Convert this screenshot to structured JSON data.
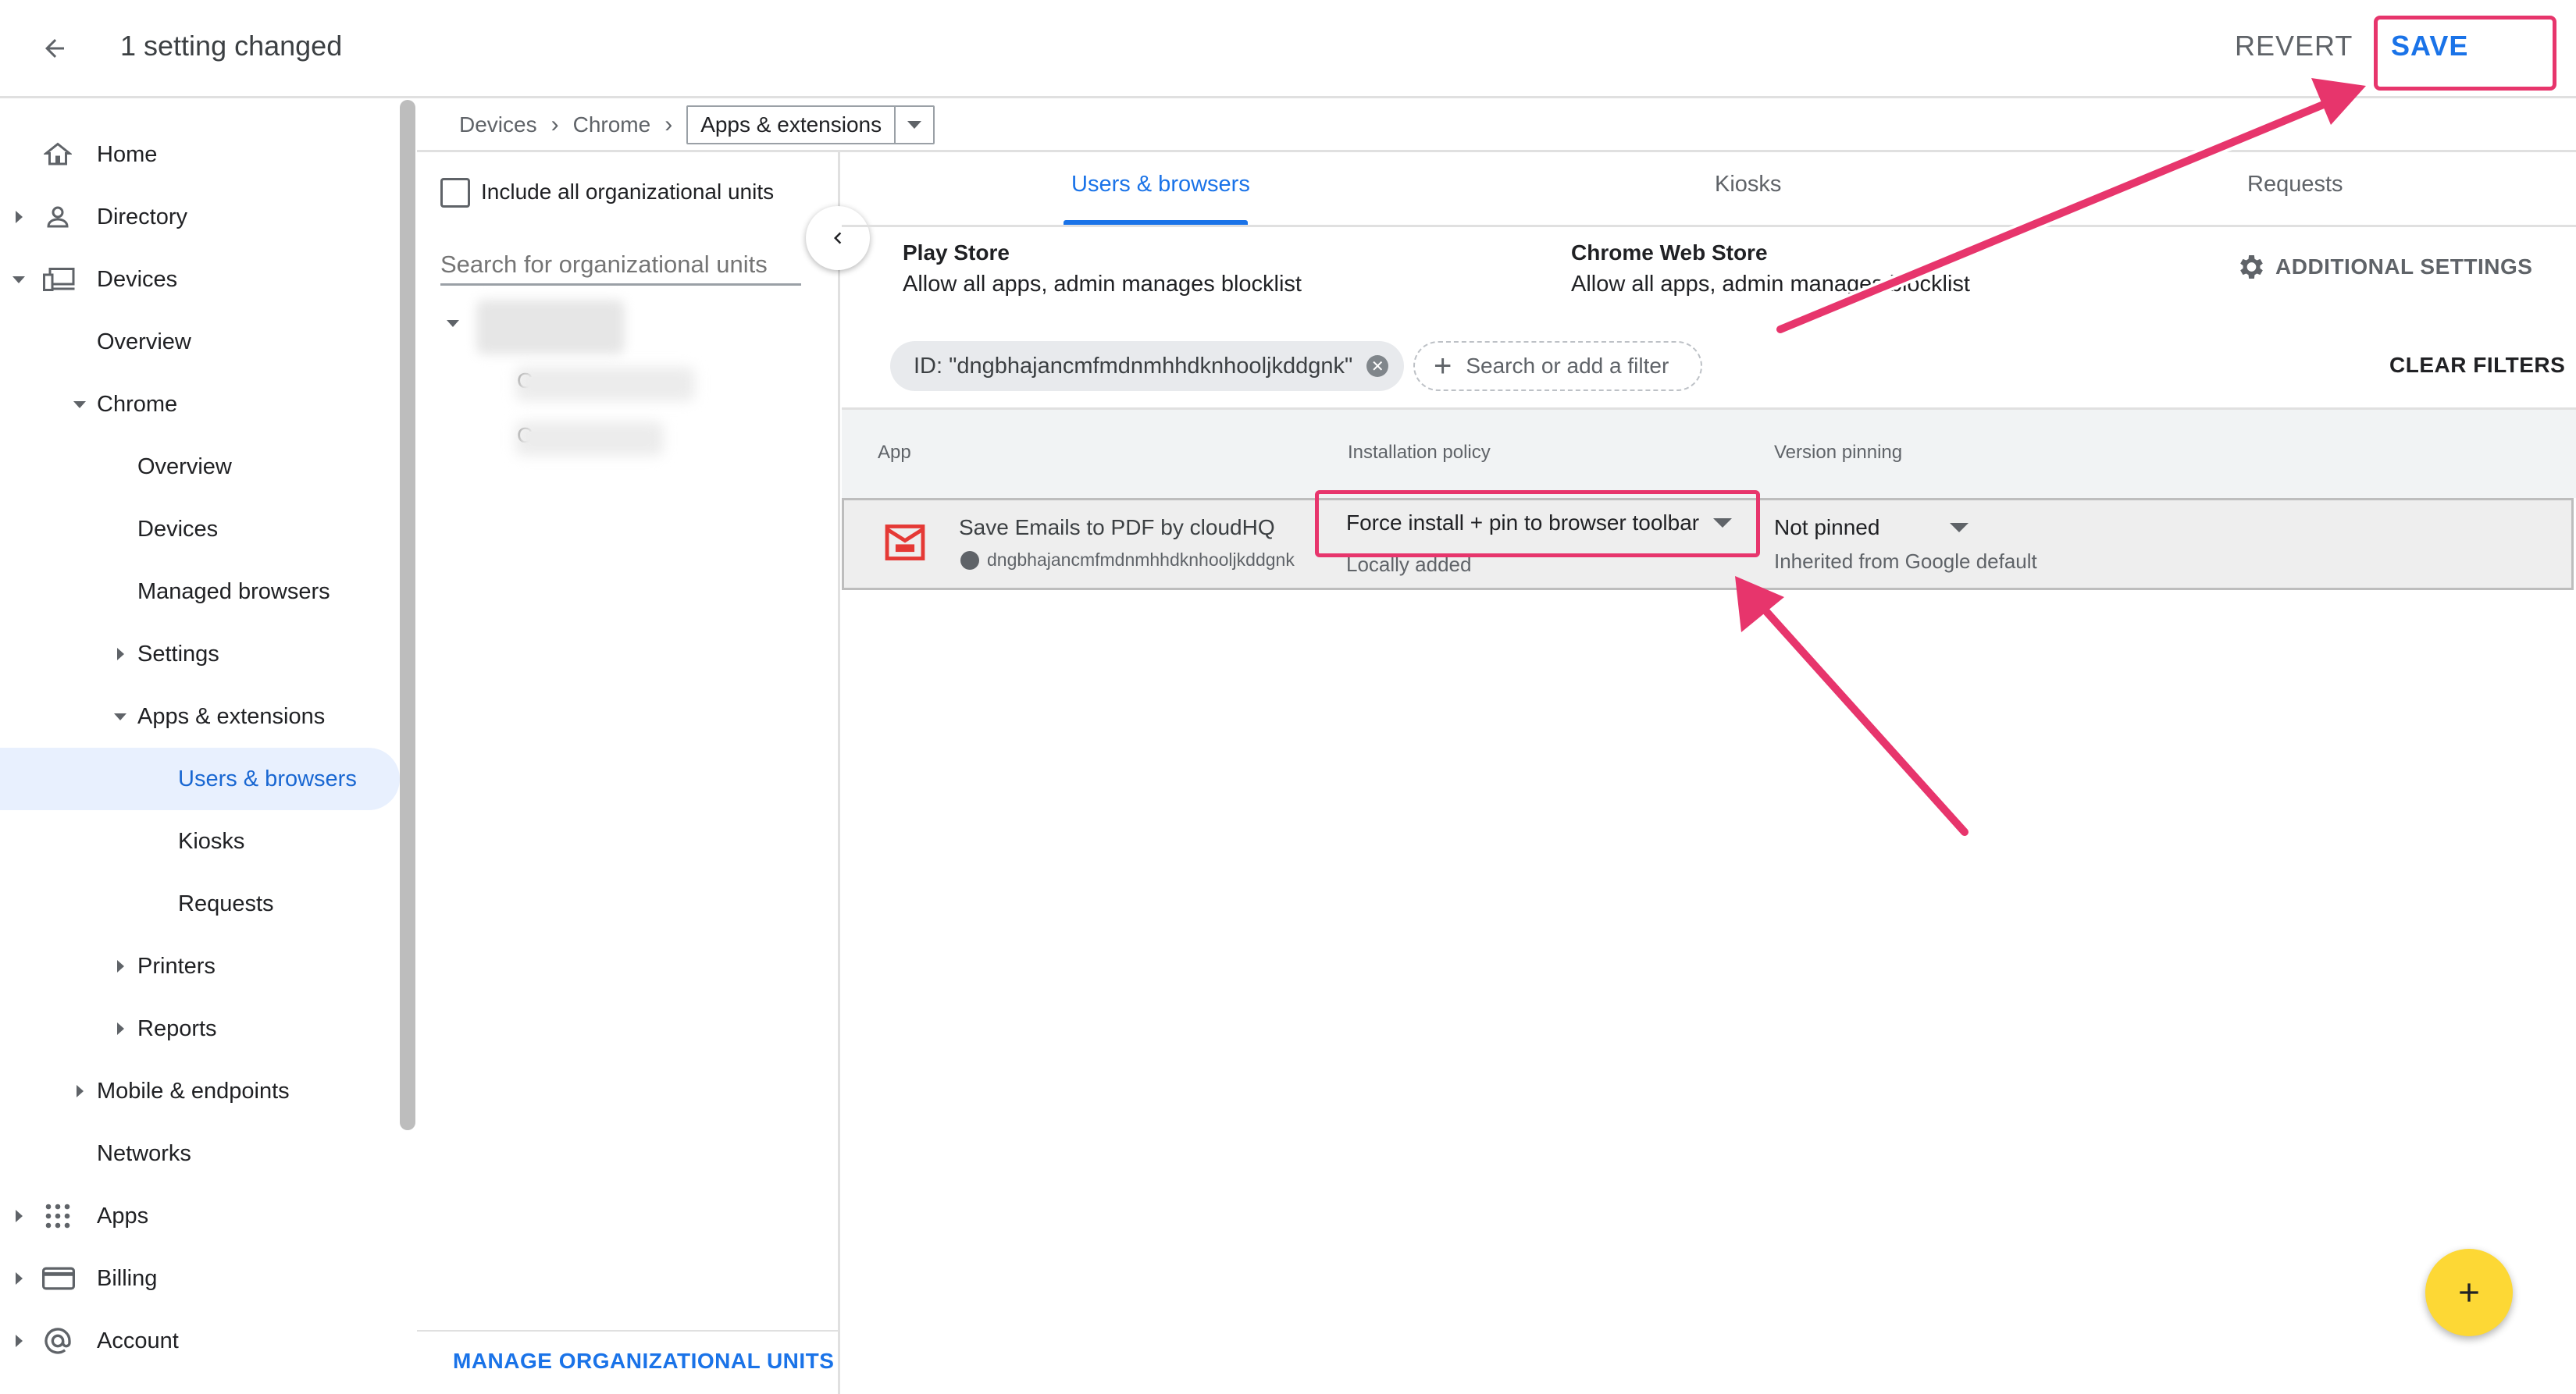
{
  "header": {
    "title": "1 setting changed",
    "revert_label": "REVERT",
    "save_label": "SAVE"
  },
  "sidebar": {
    "items": [
      {
        "label": "Home",
        "icon": "home-icon"
      },
      {
        "label": "Directory",
        "icon": "person-icon"
      },
      {
        "label": "Devices",
        "icon": "devices-icon"
      },
      {
        "label": "Overview"
      },
      {
        "label": "Chrome"
      },
      {
        "label": "Overview"
      },
      {
        "label": "Devices"
      },
      {
        "label": "Managed browsers"
      },
      {
        "label": "Settings"
      },
      {
        "label": "Apps & extensions"
      },
      {
        "label": "Users & browsers"
      },
      {
        "label": "Kiosks"
      },
      {
        "label": "Requests"
      },
      {
        "label": "Printers"
      },
      {
        "label": "Reports"
      },
      {
        "label": "Mobile & endpoints"
      },
      {
        "label": "Networks"
      },
      {
        "label": "Apps",
        "icon": "apps-grid-icon"
      },
      {
        "label": "Billing",
        "icon": "credit-card-icon"
      },
      {
        "label": "Account",
        "icon": "at-sign-icon"
      }
    ]
  },
  "breadcrumb": {
    "items": [
      "Devices",
      "Chrome"
    ],
    "current": "Apps & extensions"
  },
  "org_panel": {
    "include_label": "Include all organizational units",
    "search_placeholder": "Search for organizational units",
    "tree_fragments": [
      "C",
      "C"
    ],
    "manage_label": "MANAGE ORGANIZATIONAL UNITS"
  },
  "tabs": [
    "Users & browsers",
    "Kiosks",
    "Requests"
  ],
  "stores": {
    "play_title": "Play Store",
    "play_sub": "Allow all apps, admin manages blocklist",
    "web_title": "Chrome Web Store",
    "web_sub": "Allow all apps, admin manages blocklist"
  },
  "additional_settings": "ADDITIONAL SETTINGS",
  "filters": {
    "chip": "ID: \"dngbhajancmfmdnmhhdknhooljkddgnk\"",
    "add_placeholder": "Search or add a filter",
    "clear_label": "CLEAR FILTERS"
  },
  "table": {
    "headers": [
      "App",
      "Installation policy",
      "Version pinning"
    ],
    "row": {
      "name": "Save Emails to PDF by cloudHQ",
      "id": "dngbhajancmfmdnmhhdknhooljkddgnk",
      "policy": "Force install + pin to browser toolbar",
      "policy_sub": "Locally added",
      "pinning": "Not pinned",
      "pinning_sub": "Inherited from Google default"
    }
  },
  "colors": {
    "accent": "#1a73e8",
    "highlight": "#e7356c",
    "fab": "#fdd835"
  }
}
